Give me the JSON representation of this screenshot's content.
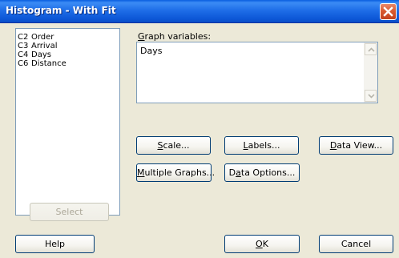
{
  "window": {
    "title": "Histogram - With Fit",
    "close_icon": "close-icon"
  },
  "variables": [
    {
      "col": "C2",
      "name": "Order"
    },
    {
      "col": "C3",
      "name": "Arrival"
    },
    {
      "col": "C4",
      "name": "Days"
    },
    {
      "col": "C6",
      "name": "Distance"
    }
  ],
  "graph_variables": {
    "label_mnemonic": "G",
    "label_rest": "raph variables:",
    "value": "Days"
  },
  "buttons": {
    "scale": {
      "mnemonic": "S",
      "rest": "cale..."
    },
    "labels": {
      "mnemonic": "L",
      "rest": "abels..."
    },
    "data_view": {
      "mnemonic": "D",
      "rest": "ata View..."
    },
    "multiple_graphs": {
      "mnemonic": "M",
      "rest": "ultiple Graphs..."
    },
    "data_options": {
      "pre": "D",
      "mnemonic": "a",
      "rest": "ta Options..."
    },
    "select": "Select",
    "help": "Help",
    "ok": {
      "mnemonic": "O",
      "rest": "K"
    },
    "cancel": "Cancel"
  }
}
